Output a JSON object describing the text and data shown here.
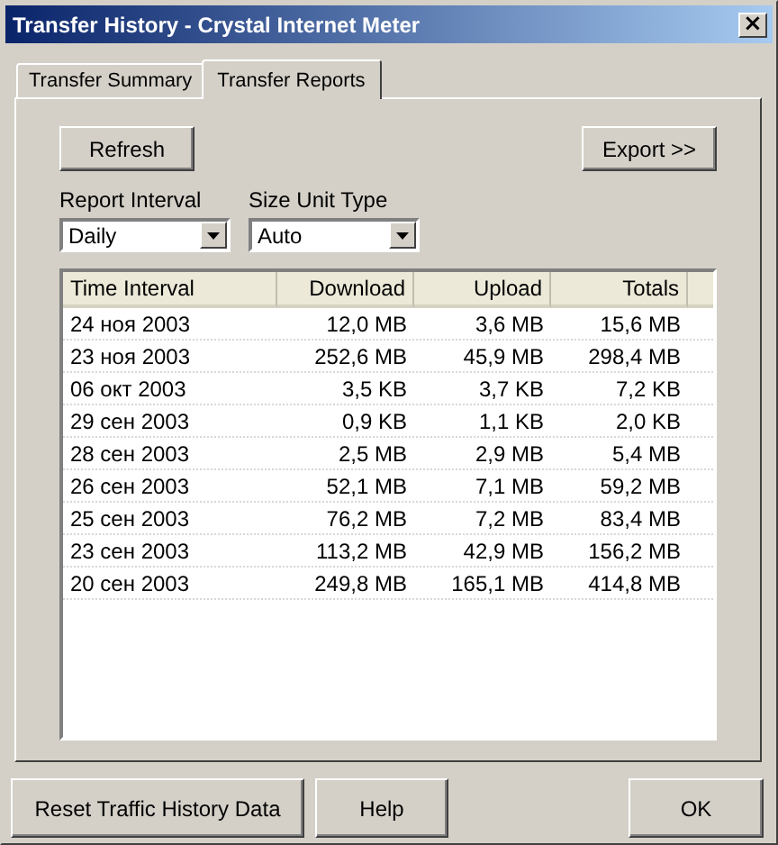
{
  "window": {
    "title": "Transfer History - Crystal Internet Meter",
    "close": "×"
  },
  "tabs": [
    {
      "label": "Transfer Summary",
      "selected": false
    },
    {
      "label": "Transfer Reports",
      "selected": true
    }
  ],
  "toolbar": {
    "refresh": "Refresh",
    "export": "Export >>"
  },
  "filters": [
    {
      "label": "Report Interval",
      "value": "Daily"
    },
    {
      "label": "Size Unit Type",
      "value": "Auto"
    }
  ],
  "table": {
    "columns": [
      "Time Interval",
      "Download",
      "Upload",
      "Totals"
    ],
    "rows": [
      [
        "24 ноя 2003",
        "12,0 MB",
        "3,6 MB",
        "15,6 MB"
      ],
      [
        "23 ноя 2003",
        "252,6 MB",
        "45,9 MB",
        "298,4 MB"
      ],
      [
        "06 окт 2003",
        "3,5 KB",
        "3,7 KB",
        "7,2 KB"
      ],
      [
        "29 сен 2003",
        "0,9 KB",
        "1,1 KB",
        "2,0 KB"
      ],
      [
        "28 сен 2003",
        "2,5 MB",
        "2,9 MB",
        "5,4 MB"
      ],
      [
        "26 сен 2003",
        "52,1 MB",
        "7,1 MB",
        "59,2 MB"
      ],
      [
        "25 сен 2003",
        "76,2 MB",
        "7,2 MB",
        "83,4 MB"
      ],
      [
        "23 сен 2003",
        "113,2 MB",
        "42,9 MB",
        "156,2 MB"
      ],
      [
        "20 сен 2003",
        "249,8 MB",
        "165,1 MB",
        "414,8 MB"
      ]
    ]
  },
  "buttons": [
    "Reset Traffic History Data",
    "Help",
    "OK"
  ]
}
